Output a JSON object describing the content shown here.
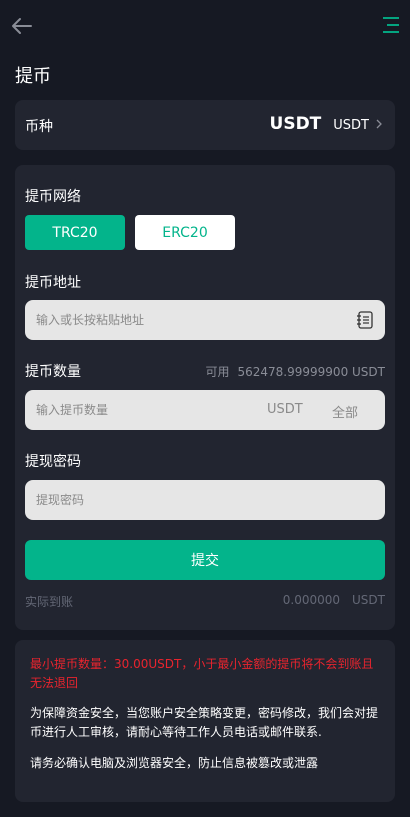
{
  "header": {
    "title": "提币",
    "back_icon": "arrow-left-icon",
    "menu_icon": "menu-icon"
  },
  "currency": {
    "label": "币种",
    "selected_big": "USDT",
    "selected_small": "USDT"
  },
  "form": {
    "network_label": "提币网络",
    "networks": [
      {
        "label": "TRC20",
        "active": true
      },
      {
        "label": "ERC20",
        "active": false
      }
    ],
    "address_label": "提币地址",
    "address_placeholder": "输入或长按粘贴地址",
    "quantity_label": "提币数量",
    "available_label": "可用",
    "available_value": "562478.99999900 USDT",
    "quantity_placeholder": "输入提币数量",
    "quantity_unit": "USDT",
    "all_label": "全部",
    "password_label": "提现密码",
    "password_placeholder": "提现密码",
    "submit_label": "提交",
    "arrival_label": "实际到账",
    "arrival_amount": "0.000000",
    "arrival_unit": "USDT"
  },
  "notice": {
    "warning": "最小提币数量：30.00USDT，小于最小金额的提币将不会到账且无法退回",
    "para1": "为保障资金安全，当您账户安全策略变更，密码修改，我们会对提币进行人工审核，请耐心等待工作人员电话或邮件联系.",
    "para2": "请务必确认电脑及浏览器安全，防止信息被篡改或泄露"
  },
  "colors": {
    "background": "#161923",
    "card": "#222530",
    "accent": "#03b48b",
    "warning": "#e8242e"
  }
}
